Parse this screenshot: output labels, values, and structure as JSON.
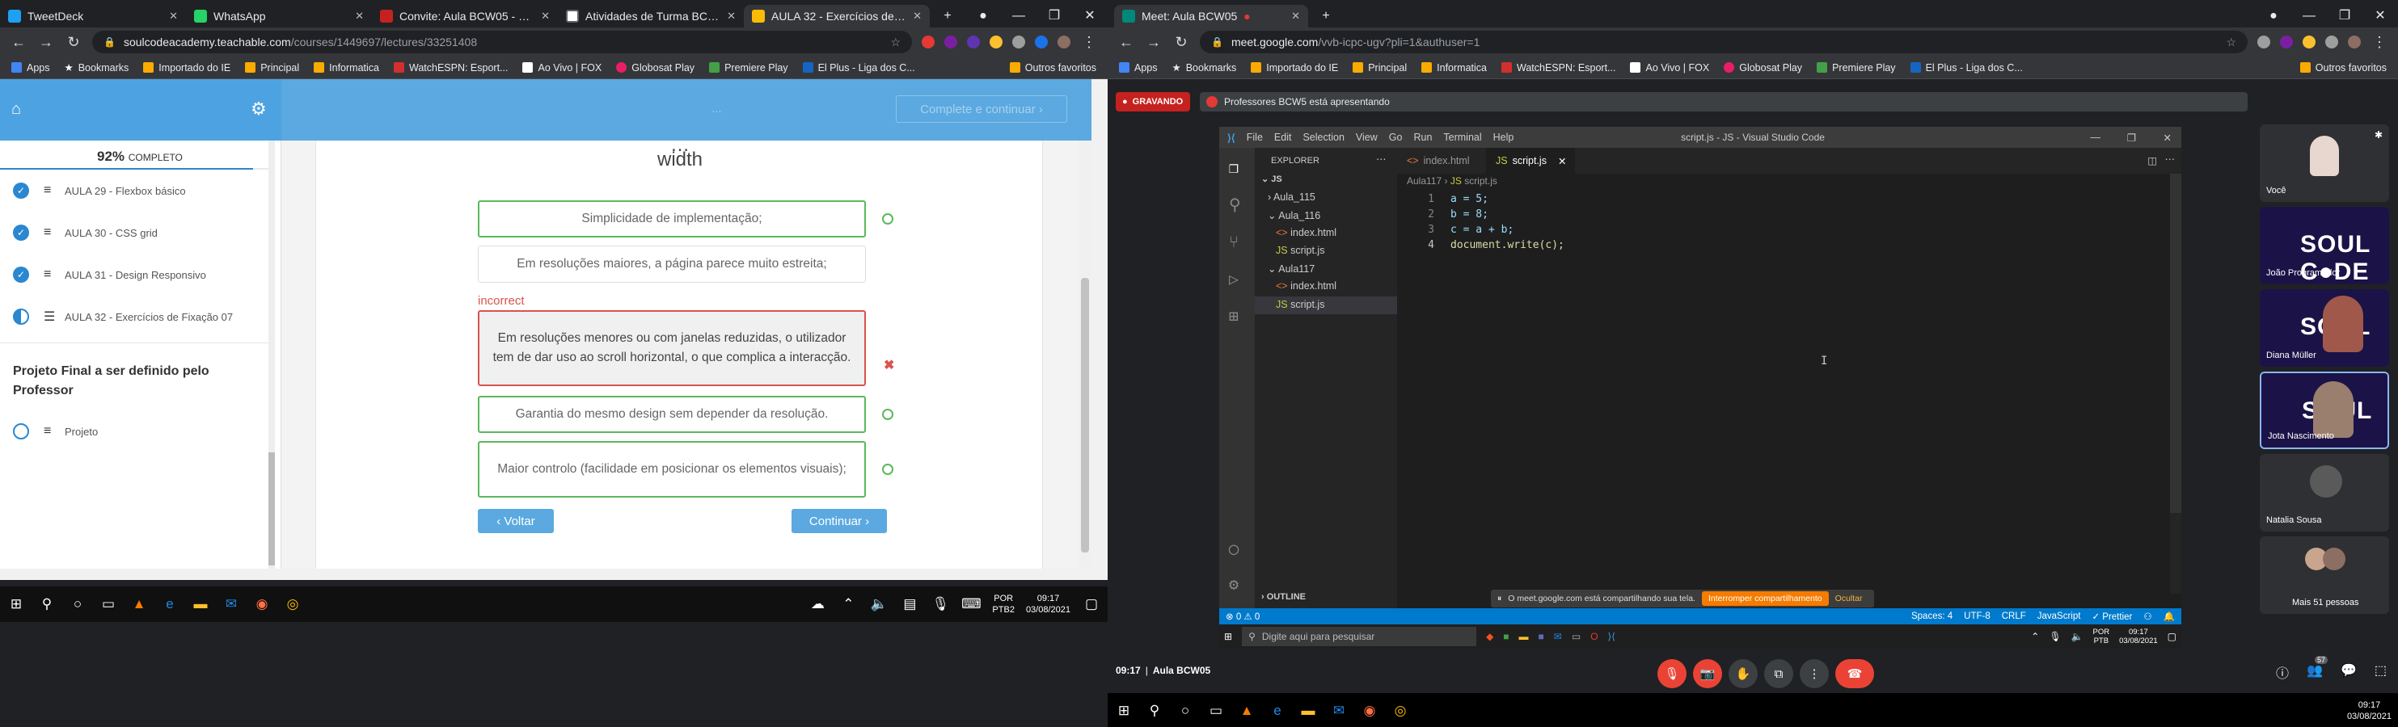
{
  "left": {
    "tabs": [
      {
        "label": "TweetDeck",
        "color": "#1da1f2"
      },
      {
        "label": "WhatsApp",
        "color": "#25d366"
      },
      {
        "label": "Convite: Aula BCW05 - Sema",
        "color": "#c5221f"
      },
      {
        "label": "Atividades de Turma BCW 5",
        "color": "#3c4043"
      },
      {
        "label": "AULA 32 - Exercícios de Fixaç",
        "color": "#fbbc04"
      }
    ],
    "url": {
      "host": "soulcodeacademy.teachable.com",
      "path": "/courses/1449697/lectures/33251408"
    },
    "bookmarks": [
      "Apps",
      "Bookmarks",
      "Importado do IE",
      "Principal",
      "Informatica",
      "WatchESPN: Esport...",
      "Ao Vivo | FOX",
      "Globosat Play",
      "Premiere Play",
      "El Plus - Liga dos C..."
    ],
    "other_bookmarks": "Outros favoritos",
    "header": {
      "complete_btn": "Complete e continuar",
      "faded_text": "..."
    },
    "sidebar": {
      "percent": "92%",
      "complete_label": "COMPLETO",
      "lessons": [
        {
          "label": "AULA 29 - Flexbox básico"
        },
        {
          "label": "AULA 30 - CSS grid"
        },
        {
          "label": "AULA 31 - Design Responsivo"
        },
        {
          "label": "AULA 32 - Exercícios de Fixação 07"
        }
      ],
      "section": "Projeto Final a ser definido pelo Professor",
      "project": "Projeto"
    },
    "quiz": {
      "heading": "width",
      "options": [
        "Simplicidade de implementação;",
        "Em resoluções maiores, a página parece muito estreita;",
        "Em resoluções menores ou com janelas reduzidas, o utilizador tem de dar uso ao scroll horizontal, o que complica a interacção.",
        "Garantia do mesmo design sem depender da resolução.",
        "Maior controlo (facilidade em posicionar os elementos visuais);"
      ],
      "incorrect_label": "incorrect",
      "back_btn": "‹ Voltar",
      "continue_btn": "Continuar ›"
    },
    "taskbar": {
      "lang": "POR",
      "layout": "PTB2",
      "time": "09:17",
      "date": "03/08/2021"
    }
  },
  "right": {
    "tab_title": "Meet: Aula BCW05",
    "url": {
      "host": "meet.google.com",
      "path": "/vvb-icpc-ugv?pli=1&authuser=1"
    },
    "bookmarks": [
      "Apps",
      "Bookmarks",
      "Importado do IE",
      "Principal",
      "Informatica",
      "WatchESPN: Esport...",
      "Ao Vivo | FOX",
      "Globosat Play",
      "Premiere Play",
      "El Plus - Liga dos C..."
    ],
    "other_bookmarks": "Outros favoritos",
    "recording": "GRAVANDO",
    "presenting": "Professores BCW5 está apresentando",
    "vscode": {
      "title": "script.js - JS - Visual Studio Code",
      "menu": [
        "File",
        "Edit",
        "Selection",
        "View",
        "Go",
        "Run",
        "Terminal",
        "Help"
      ],
      "explorer": "EXPLORER",
      "root": "JS",
      "tree": [
        "Aula_115",
        "Aula_116",
        "index.html",
        "script.js",
        "Aula117",
        "index.html",
        "script.js"
      ],
      "tabs": [
        "index.html",
        "script.js"
      ],
      "breadcrumb": [
        "Aula117",
        "script.js"
      ],
      "code": [
        "a = 5;",
        "b = 8;",
        "c = a + b;",
        "document.write(c);"
      ],
      "outline": "OUTLINE",
      "status_left": "⊗ 0 ⚠ 0",
      "status_right": [
        "Spaces: 4",
        "UTF-8",
        "CRLF",
        "JavaScript",
        "✓ Prettier"
      ],
      "share_msg": "O meet.google.com está compartilhando sua tela.",
      "share_stop": "Interromper compartilhamento",
      "share_hide": "Ocultar",
      "search_placeholder": "Digite aqui para pesquisar",
      "inner_time": "09:17",
      "inner_date": "03/08/2021",
      "inner_lang": "POR",
      "inner_layout": "PTB"
    },
    "participants": [
      {
        "name": "Você"
      },
      {
        "name": "João Programador"
      },
      {
        "name": "Diana Müller"
      },
      {
        "name": "Jota Nascimento"
      },
      {
        "name": "Natalia Sousa"
      },
      {
        "name": "Mais 51 pessoas"
      }
    ],
    "footer": {
      "time": "09:17",
      "meeting": "Aula BCW05",
      "badge": "57"
    },
    "taskbar": {
      "time": "09:17",
      "date": "03/08/2021"
    }
  }
}
